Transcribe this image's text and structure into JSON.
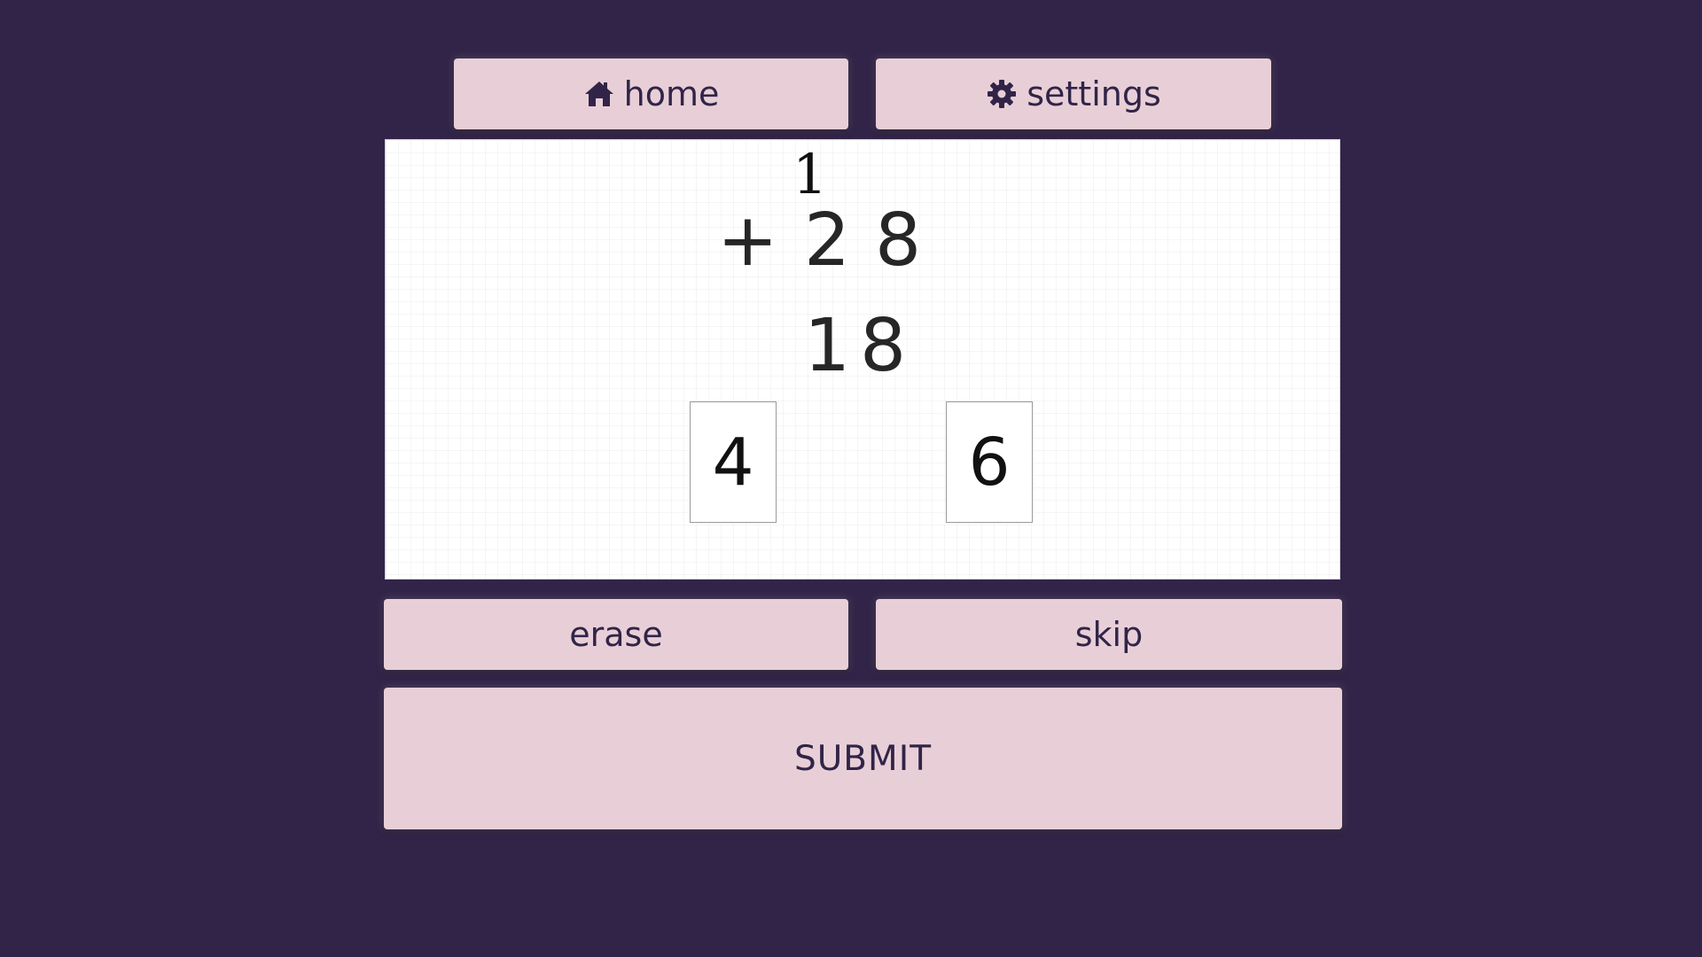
{
  "nav": {
    "home_label": "home",
    "home_icon": "home-icon",
    "settings_label": "settings",
    "settings_icon": "gear-icon"
  },
  "problem": {
    "carry": "1",
    "operator": "+",
    "top_digits": [
      "2",
      "8"
    ],
    "bottom_digits": [
      "1",
      "8"
    ]
  },
  "answer_tiles": [
    "4",
    "6"
  ],
  "actions": {
    "erase_label": "erase",
    "skip_label": "skip",
    "submit_label": "SUBMIT"
  },
  "colors": {
    "background": "#312448",
    "button": "#e8cfd7",
    "button_text": "#312448",
    "canvas": "#ffffff"
  }
}
